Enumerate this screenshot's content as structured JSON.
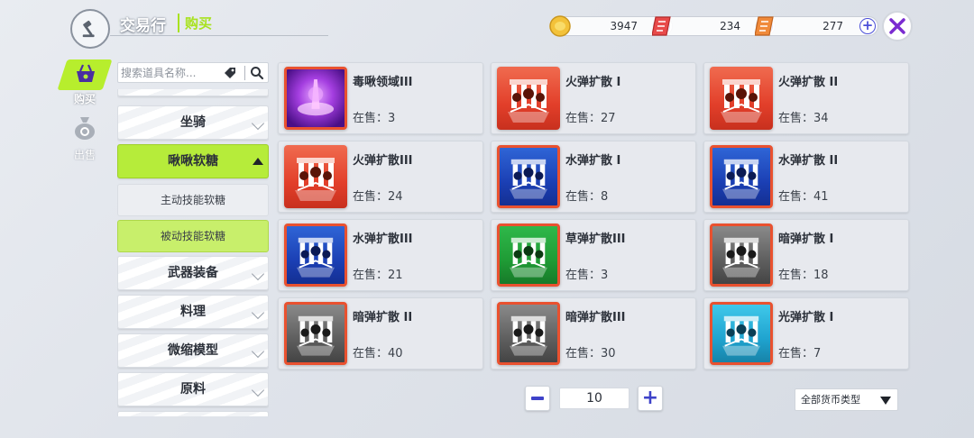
{
  "header": {
    "title": "交易行",
    "subtitle": "购买"
  },
  "currencies": [
    {
      "icon": "gold-coin-icon",
      "amount": "3947",
      "color": "#f3c23a"
    },
    {
      "icon": "red-ticket-icon",
      "amount": "234",
      "color": "#e84a4a"
    },
    {
      "icon": "orange-ticket-icon",
      "amount": "277",
      "color": "#f08a3a"
    }
  ],
  "nav": {
    "buy_label": "购买",
    "sell_label": "出售"
  },
  "search": {
    "placeholder": "搜索道具名称..."
  },
  "categories": {
    "mount": "坐骑",
    "candy": "啾啾软糖",
    "candy_sub_active": "主动技能软糖",
    "candy_sub_passive": "被动技能软糖",
    "weapon": "武器装备",
    "cooking": "料理",
    "model": "微缩模型",
    "material": "原料"
  },
  "items": [
    {
      "name": "毒啾领域III",
      "stock": "在售：3",
      "color": "purple"
    },
    {
      "name": "火弹扩散 I",
      "stock": "在售：27",
      "color": "red"
    },
    {
      "name": "火弹扩散 II",
      "stock": "在售：34",
      "color": "red"
    },
    {
      "name": "火弹扩散III",
      "stock": "在售：24",
      "color": "red"
    },
    {
      "name": "水弹扩散 I",
      "stock": "在售：8",
      "color": "blue"
    },
    {
      "name": "水弹扩散 II",
      "stock": "在售：41",
      "color": "blue"
    },
    {
      "name": "水弹扩散III",
      "stock": "在售：21",
      "color": "blue"
    },
    {
      "name": "草弹扩散III",
      "stock": "在售：3",
      "color": "green"
    },
    {
      "name": "暗弹扩散 I",
      "stock": "在售：18",
      "color": "gray"
    },
    {
      "name": "暗弹扩散 II",
      "stock": "在售：40",
      "color": "gray"
    },
    {
      "name": "暗弹扩散III",
      "stock": "在售：30",
      "color": "gray"
    },
    {
      "name": "光弹扩散 I",
      "stock": "在售：7",
      "color": "cyan"
    }
  ],
  "pagination": {
    "value": "10"
  },
  "filter": {
    "label": "全部货币类型"
  },
  "colors": {
    "accent": "#b6ec3a",
    "button_blue": "#3e42c9",
    "close_x": "#7a2bd0"
  }
}
